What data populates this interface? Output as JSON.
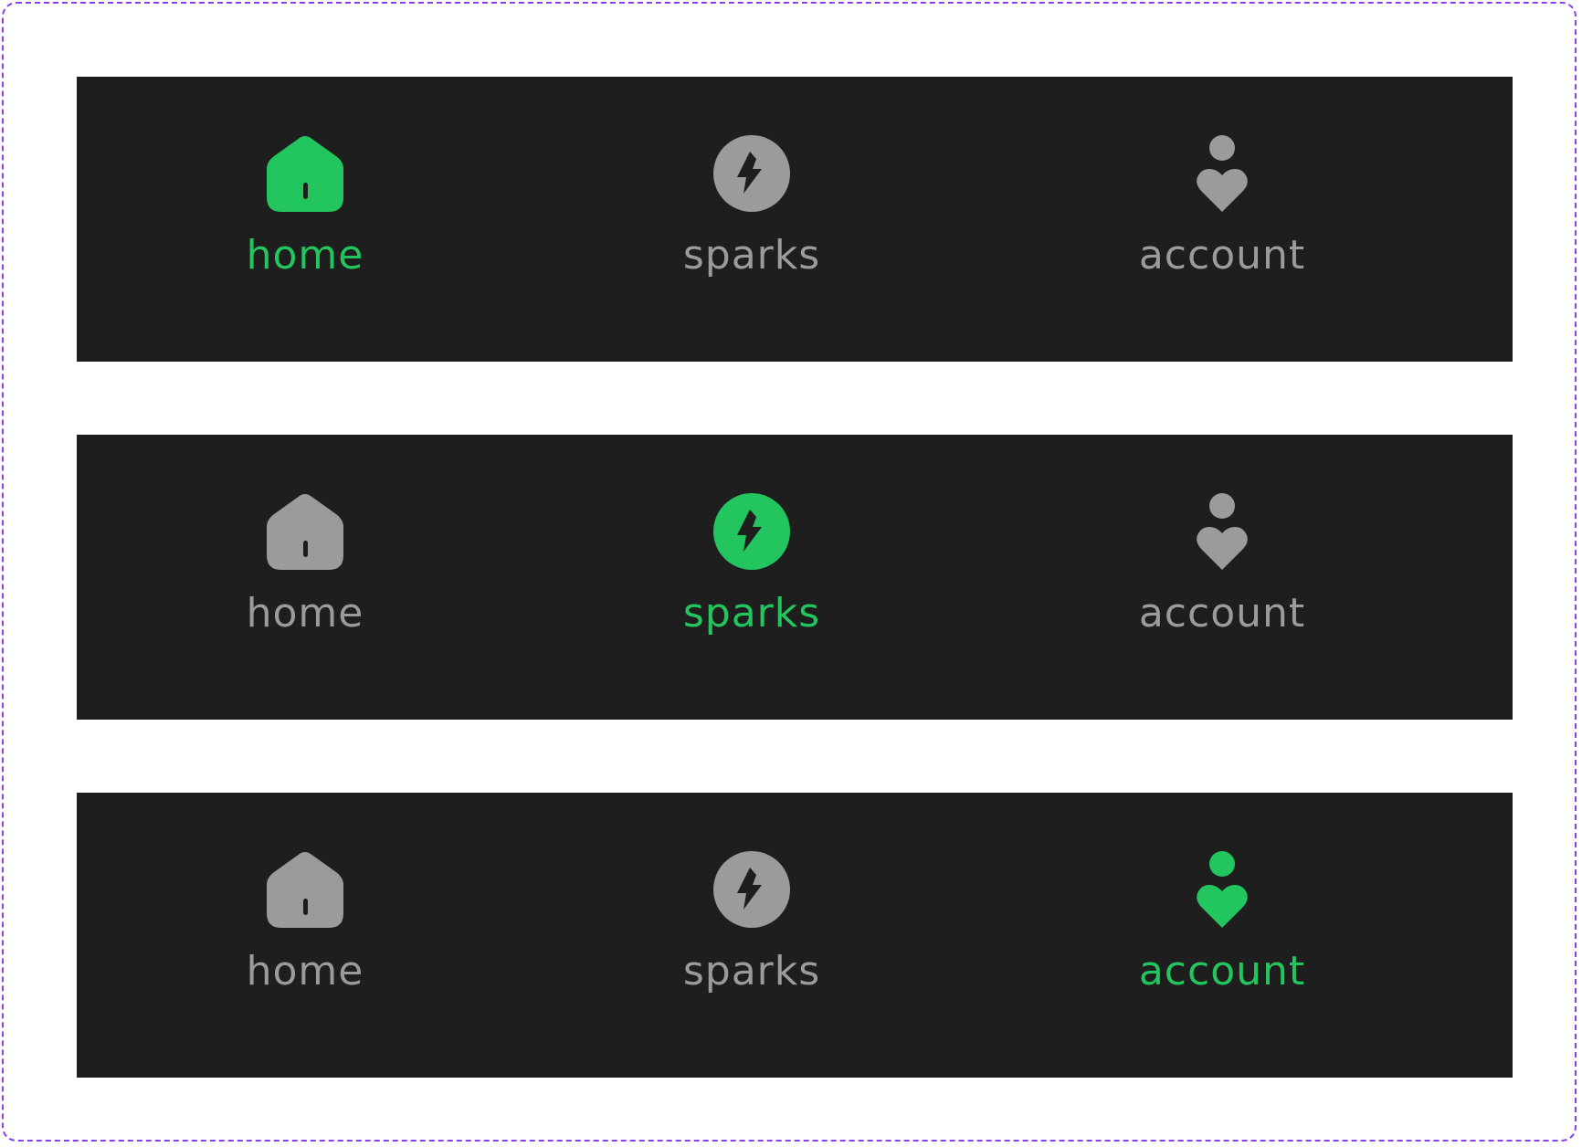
{
  "colors": {
    "active": "#22c55e",
    "inactive": "#9b9b9b",
    "background": "#1e1e1e",
    "frame_border": "#8a3ff0"
  },
  "navbars": [
    {
      "active": "home",
      "items": [
        {
          "label": "home",
          "icon": "home-icon"
        },
        {
          "label": "sparks",
          "icon": "lightning-bolt-icon"
        },
        {
          "label": "account",
          "icon": "person-heart-icon"
        }
      ]
    },
    {
      "active": "sparks",
      "items": [
        {
          "label": "home",
          "icon": "home-icon"
        },
        {
          "label": "sparks",
          "icon": "lightning-bolt-icon"
        },
        {
          "label": "account",
          "icon": "person-heart-icon"
        }
      ]
    },
    {
      "active": "account",
      "items": [
        {
          "label": "home",
          "icon": "home-icon"
        },
        {
          "label": "sparks",
          "icon": "lightning-bolt-icon"
        },
        {
          "label": "account",
          "icon": "person-heart-icon"
        }
      ]
    }
  ]
}
